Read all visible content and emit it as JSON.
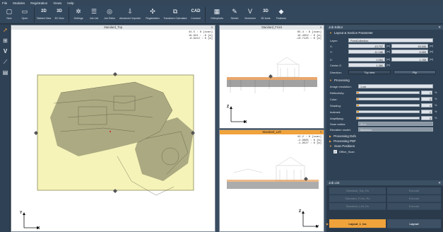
{
  "menu": [
    "File",
    "Modules",
    "Registration",
    "Views",
    "Help"
  ],
  "toolbar": [
    {
      "label": "New",
      "icon": "file-icon",
      "glyph": "▢"
    },
    {
      "label": "Open",
      "icon": "folder-icon",
      "glyph": "▭"
    },
    {
      "label": "Tabbed View",
      "icon": "tabbed-view-icon",
      "glyph": "2D"
    },
    {
      "label": "3D View",
      "icon": "3d-view-icon",
      "glyph": "3D"
    },
    {
      "label": "Settings",
      "icon": "gear-icon",
      "glyph": "✲"
    },
    {
      "label": "Job List",
      "icon": "list-icon",
      "glyph": "☰"
    },
    {
      "label": "Job Editor",
      "icon": "target-icon",
      "glyph": "◎"
    },
    {
      "label": "Advanced Importer",
      "icon": "import-icon",
      "glyph": "⇩"
    },
    {
      "label": "Registration",
      "icon": "registration-icon",
      "glyph": "✣"
    },
    {
      "label": "Transform Calculator",
      "icon": "transform-icon",
      "glyph": "⧉"
    },
    {
      "label": "Connect",
      "icon": "cad-icon",
      "glyph": "CAD"
    },
    {
      "label": "Orthophoto",
      "icon": "orthophoto-icon",
      "glyph": "▦"
    },
    {
      "label": "Sketch",
      "icon": "sketch-icon",
      "glyph": "✎"
    },
    {
      "label": "Vectorizer",
      "icon": "vectorizer-icon",
      "glyph": "V"
    },
    {
      "label": "3D tools",
      "icon": "3d-tools-icon",
      "glyph": "3D"
    },
    {
      "label": "Features",
      "icon": "features-icon",
      "glyph": "◆"
    }
  ],
  "left_tools": [
    "cursor-icon",
    "measure-icon",
    "vector-icon",
    "line-icon",
    "layers-icon"
  ],
  "views": {
    "top": {
      "title": "Standard_Top",
      "coords": [
        "44.5 : 8 [scan]",
        "19.921 : -8 [m]",
        "-8.9412 : 8 [m]"
      ],
      "axis_v": "Y",
      "axis_h": "X"
    },
    "front": {
      "title": "Standard_Front",
      "coords": [
        "65.4 : 8 [scan]",
        "19.4352 : 8 [m]",
        "-10.7125 : 8 [m]"
      ],
      "axis_v": "Z",
      "axis_h": "X"
    },
    "left": {
      "title": "Standard_Left",
      "coords": [
        "42.2 : 8 [scan]",
        "-2.9685 : 8 [m]",
        "-1.9527 : 8 [m]"
      ],
      "axis_v": "Z",
      "axis_h": "Y"
    }
  },
  "job_editor": {
    "title": "Job Editor",
    "layout_section": "Layout & Section Parameter",
    "layer_label": "Layer:",
    "layer_value": "PointCollection",
    "x_label": "X:",
    "x_min": "-13.737",
    "x_max": "16.340",
    "y_label": "Y:",
    "y_min": "-11.186",
    "y_max": "6.559",
    "z_label": "Z:",
    "z_min": "1.054",
    "z_max": "1.785",
    "center_label": "Center Z:",
    "center_value": "1.380",
    "unit": "[m]",
    "direction_label": "Direction:",
    "direction_value": "Top view",
    "flip_label": "Flip",
    "processing_section": "Processing",
    "image_resolution_label": "Image resolution:",
    "image_resolution_value": "1 cm",
    "sliders": [
      {
        "label": "Reflectivity:",
        "value": "0",
        "fraction": 0.03
      },
      {
        "label": "Color:",
        "value": "0",
        "fraction": 0.03
      },
      {
        "label": "Shading:",
        "value": "0",
        "fraction": 0.03
      },
      {
        "label": "Indexed:",
        "value": "0",
        "fraction": 0.03
      },
      {
        "label": "Amplifying:",
        "value": "0",
        "fraction": 0.03
      }
    ],
    "pct_unit": "%",
    "scan_radius_label": "Scan radius:",
    "scan_radius_value": "20 m",
    "elevation_label": "Elevation model:",
    "elevation_value": "Maximum",
    "processing_dxf": "Processing Dxfs",
    "processing_pdf": "Processing PDF",
    "scan_positions": "Scan Positions",
    "scan_item": "Office_Scan"
  },
  "job_list": {
    "title": "Job List",
    "rows": [
      {
        "name": "Standard_Top_Ro",
        "action": "Execute"
      },
      {
        "name": "Standard_Front_Ro",
        "action": "Execute"
      },
      {
        "name": "Standard_Left_Ro",
        "action": "Execute"
      },
      {
        "name": "Layout_1_lss",
        "action": "Layout"
      }
    ]
  },
  "colors": {
    "accent": "#f0a23b",
    "panel": "#2f4154",
    "toolbar": "#34485d",
    "section_fill": "#f5f3b8"
  }
}
